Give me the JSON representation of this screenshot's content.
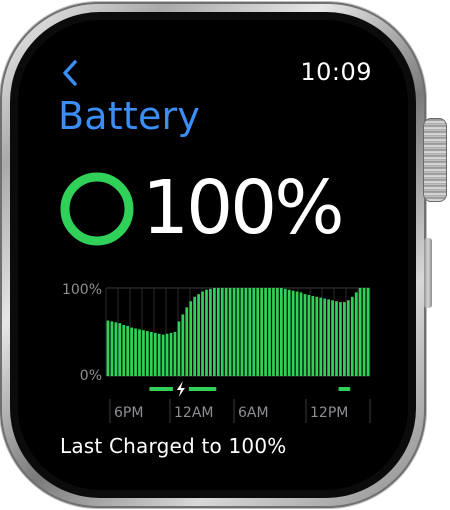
{
  "status": {
    "time": "10:09"
  },
  "header": {
    "title": "Battery"
  },
  "battery": {
    "level_percent": 100,
    "level_label": "100%"
  },
  "chart_data": {
    "type": "bar",
    "title": "",
    "y_tick_labels": [
      "100%",
      "0%"
    ],
    "x_tick_labels": [
      "6PM",
      "12AM",
      "6AM",
      "12PM"
    ],
    "ylim": [
      0,
      100
    ],
    "grid": true,
    "bar_color": "#30d158",
    "values": [
      63,
      62,
      61,
      60,
      58,
      57,
      55,
      54,
      53,
      52,
      51,
      50,
      49,
      48,
      47,
      48,
      49,
      50,
      62,
      70,
      78,
      85,
      90,
      93,
      96,
      98,
      99,
      100,
      100,
      100,
      100,
      100,
      100,
      100,
      100,
      100,
      100,
      100,
      100,
      100,
      100,
      100,
      100,
      100,
      100,
      99,
      98,
      97,
      96,
      95,
      93,
      92,
      91,
      90,
      89,
      88,
      87,
      86,
      85,
      84,
      84,
      86,
      90,
      95,
      100,
      100,
      100
    ],
    "charging_segments": [
      [
        11,
        28
      ],
      [
        59,
        62
      ]
    ],
    "charging_marker_index": 19
  },
  "footer": {
    "last_charged": "Last Charged to 100%"
  },
  "colors": {
    "accent": "#3a8ef6",
    "battery_green": "#30d158",
    "screen_bg": "#000000"
  }
}
